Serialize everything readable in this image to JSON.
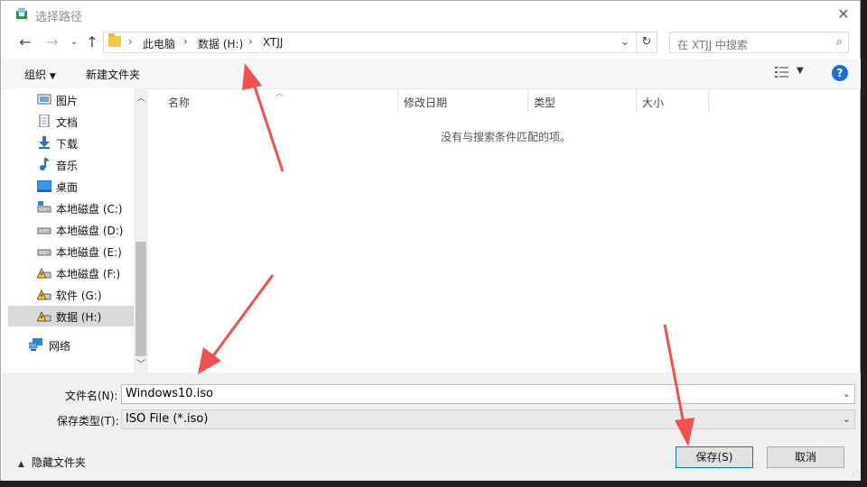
{
  "window": {
    "title": "选择路径",
    "close_icon": "close-icon"
  },
  "nav": {
    "breadcrumbs": [
      "此电脑",
      "数据 (H:)",
      "XTJJ"
    ],
    "search_placeholder": "在 XTJJ 中搜索"
  },
  "toolbar": {
    "organize_label": "组织",
    "new_folder_label": "新建文件夹",
    "help_label": "?"
  },
  "sidebar": {
    "items": [
      {
        "label": "图片",
        "icon": "pictures-icon"
      },
      {
        "label": "文档",
        "icon": "documents-icon"
      },
      {
        "label": "下载",
        "icon": "downloads-icon"
      },
      {
        "label": "音乐",
        "icon": "music-icon"
      },
      {
        "label": "桌面",
        "icon": "desktop-icon"
      },
      {
        "label": "本地磁盘 (C:)",
        "icon": "drive-icon"
      },
      {
        "label": "本地磁盘 (D:)",
        "icon": "drive-icon"
      },
      {
        "label": "本地磁盘 (E:)",
        "icon": "drive-icon"
      },
      {
        "label": "本地磁盘 (F:)",
        "icon": "warning-drive-icon"
      },
      {
        "label": "软件 (G:)",
        "icon": "warning-drive-icon"
      },
      {
        "label": "数据 (H:)",
        "icon": "warning-drive-icon",
        "selected": true
      },
      {
        "label": "网络",
        "icon": "network-icon"
      }
    ]
  },
  "filelist": {
    "columns": [
      "名称",
      "修改日期",
      "类型",
      "大小"
    ],
    "empty_message": "没有与搜索条件匹配的项。"
  },
  "form": {
    "filename_label": "文件名(N):",
    "filename_value": "Windows10.iso",
    "filetype_label": "保存类型(T):",
    "filetype_value": "ISO File (*.iso)"
  },
  "footer": {
    "hide_folders_label": "隐藏文件夹",
    "save_label": "保存(S)",
    "cancel_label": "取消"
  },
  "colors": {
    "accent": "#0078d7",
    "annotation_arrow": "#f0504f",
    "help": "#1a6fd4",
    "folder": "#f3c94c"
  }
}
